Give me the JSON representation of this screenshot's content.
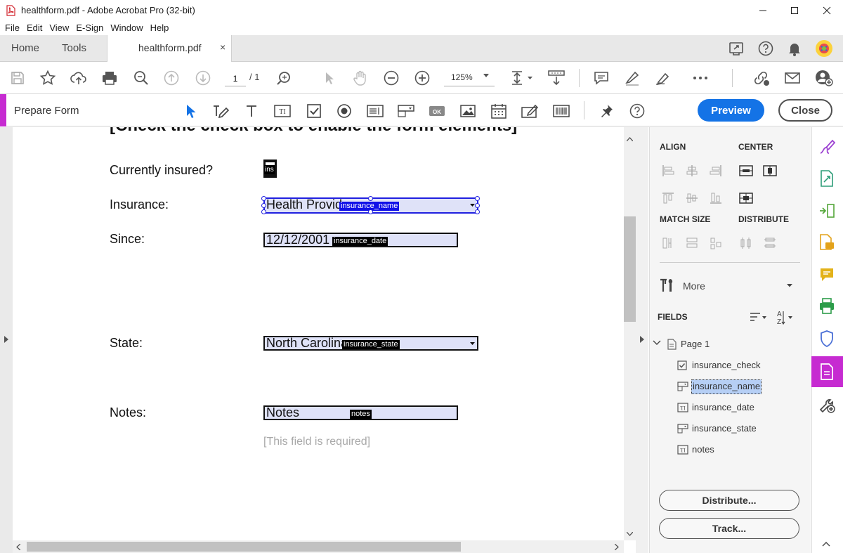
{
  "window": {
    "title": "healthform.pdf - Adobe Acrobat Pro (32-bit)"
  },
  "menu": [
    "File",
    "Edit",
    "View",
    "E-Sign",
    "Window",
    "Help"
  ],
  "tabs": {
    "home": "Home",
    "tools": "Tools",
    "document": "healthform.pdf",
    "close_glyph": "×"
  },
  "toolbar": {
    "page_current": "1",
    "page_total": "/ 1",
    "zoom": "125%"
  },
  "prepare_form": {
    "title": "Prepare Form",
    "preview_label": "Preview",
    "close_label": "Close"
  },
  "document": {
    "heading": "[Check the check box to enable the form elements]",
    "rows": [
      {
        "label": "Currently insured?"
      },
      {
        "label": "Insurance:",
        "value": "Health Provid",
        "tag": "insurance_name"
      },
      {
        "label": "Since:",
        "value": "12/12/2001",
        "tag": "insurance_date"
      },
      {
        "label": "State:",
        "value": "North Carolina",
        "tag": "insurance_state"
      },
      {
        "label": "Notes:",
        "value": "Notes",
        "tag": "notes"
      }
    ],
    "check_tag": "ins",
    "required_hint": "[This field is required]"
  },
  "panel": {
    "align": "ALIGN",
    "center": "CENTER",
    "match_size": "MATCH SIZE",
    "distribute": "DISTRIBUTE",
    "more": "More",
    "fields": "FIELDS",
    "page_node": "Page 1",
    "field_list": [
      "insurance_check",
      "insurance_name",
      "insurance_date",
      "insurance_state",
      "notes"
    ],
    "selected_field": "insurance_name",
    "distribute_btn": "Distribute...",
    "track_btn": "Track..."
  },
  "colors": {
    "accent_magenta": "#c62bd1",
    "preview_blue": "#1473e6",
    "field_fill": "#dfe2f8",
    "selection_blue": "#2020e0"
  }
}
